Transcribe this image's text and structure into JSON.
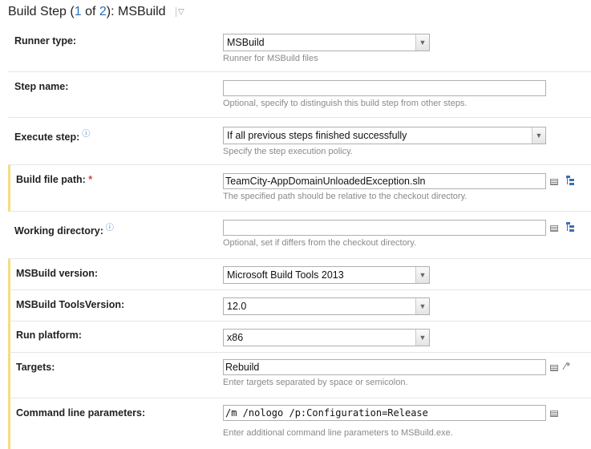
{
  "header": {
    "prefix": "Build Step (",
    "current": "1",
    "of": " of ",
    "total": "2",
    "suffix": "): MSBuild"
  },
  "fields": {
    "runner_type": {
      "label": "Runner type:",
      "value": "MSBuild",
      "hint": "Runner for MSBuild files"
    },
    "step_name": {
      "label": "Step name:",
      "value": "",
      "hint": "Optional, specify to distinguish this build step from other steps."
    },
    "execute_step": {
      "label": "Execute step:",
      "value": "If all previous steps finished successfully",
      "hint": "Specify the step execution policy."
    },
    "build_file_path": {
      "label": "Build file path:",
      "required_mark": "*",
      "value": "TeamCity-AppDomainUnloadedException.sln",
      "hint": "The specified path should be relative to the checkout directory."
    },
    "working_directory": {
      "label": "Working directory:",
      "value": "",
      "hint": "Optional, set if differs from the checkout directory."
    },
    "msbuild_version": {
      "label": "MSBuild version:",
      "value": "Microsoft Build Tools 2013"
    },
    "tools_version": {
      "label": "MSBuild ToolsVersion:",
      "value": "12.0"
    },
    "run_platform": {
      "label": "Run platform:",
      "value": "x86"
    },
    "targets": {
      "label": "Targets:",
      "value": "Rebuild",
      "hint": "Enter targets separated by space or semicolon."
    },
    "command_line": {
      "label": "Command line parameters:",
      "value": "/m /nologo /p:Configuration=Release",
      "hint": "Enter additional command line parameters to MSBuild.exe."
    }
  },
  "icons": {
    "help": "help-icon",
    "dropdown": "chevron-down-icon",
    "expand_editor": "text-editor-icon",
    "tree_browser": "tree-browser-icon",
    "magic_wand": "magic-wand-icon"
  },
  "colors": {
    "accent_link": "#2a6db0",
    "required": "#d04437",
    "marked_row_bar": "#f2de7c",
    "hint_text": "#8a8a8a"
  }
}
